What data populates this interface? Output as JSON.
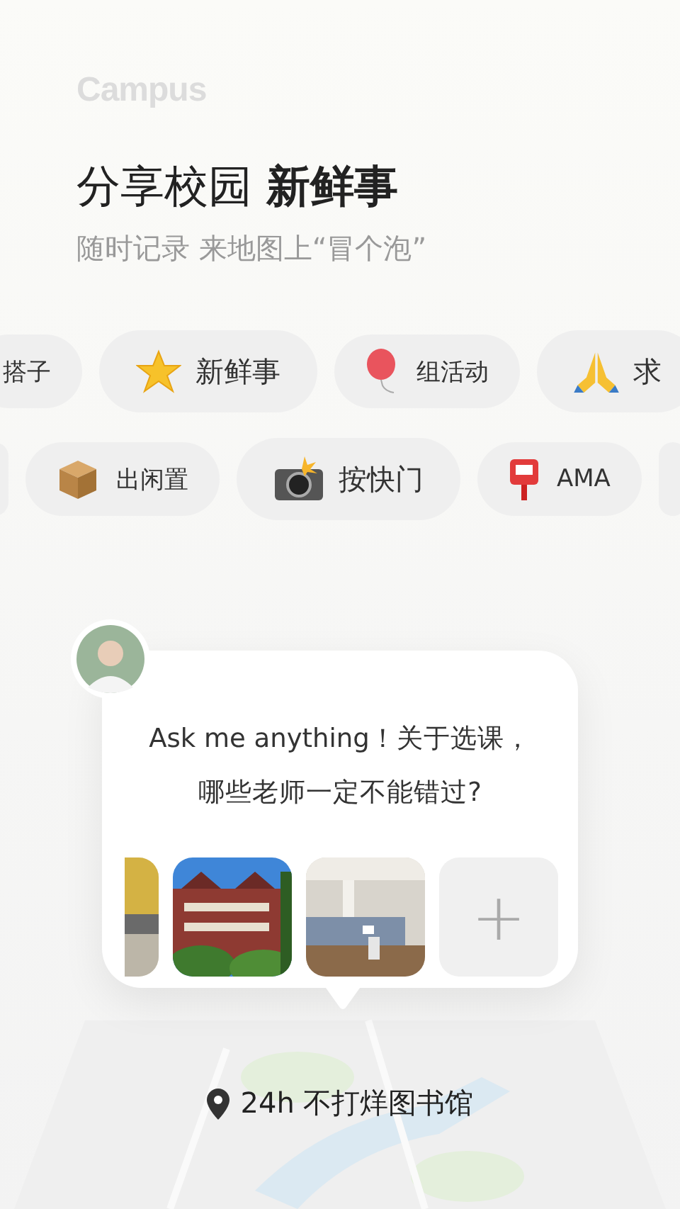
{
  "brand": "Campus",
  "headline": {
    "plain": "分享校园",
    "bold": "新鲜事"
  },
  "subtitle": "随时记录 来地图上“冒个泡”",
  "chip_rows": [
    {
      "chips": [
        {
          "label": "搭子",
          "kind": "small"
        },
        {
          "label": "新鲜事",
          "kind": "large"
        },
        {
          "label": "组活动",
          "kind": "small"
        },
        {
          "label": "求",
          "kind": "large"
        }
      ]
    },
    {
      "chips": [
        {
          "kind": "stub"
        },
        {
          "label": "出闲置",
          "kind": "small"
        },
        {
          "label": "按快门",
          "kind": "large"
        },
        {
          "label": "AMA",
          "kind": "small"
        },
        {
          "kind": "stub"
        }
      ]
    }
  ],
  "post": {
    "lines": [
      "Ask me anything！关于选课，",
      "哪些老师一定不能错过?"
    ],
    "photos": [
      {
        "kind": "picture"
      },
      {
        "kind": "picture"
      },
      {
        "kind": "picture"
      }
    ],
    "add_label": "+"
  },
  "location": "24h 不打烊图书馆"
}
